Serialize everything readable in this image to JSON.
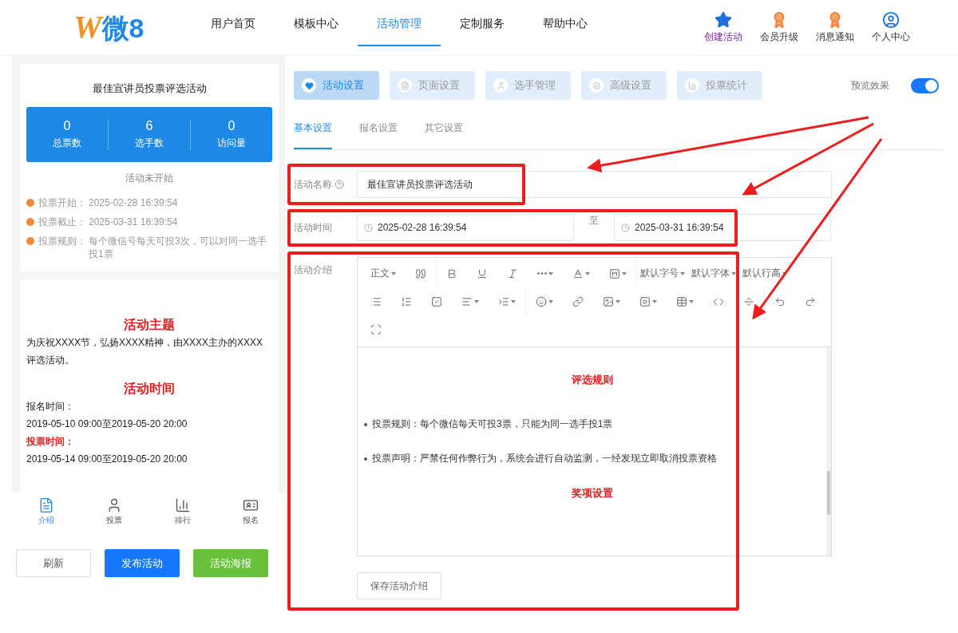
{
  "header": {
    "logo_mark": "W",
    "logo_text": "微8",
    "nav": [
      {
        "label": "用户首页",
        "selected": false
      },
      {
        "label": "模板中心",
        "selected": false
      },
      {
        "label": "活动管理",
        "selected": true
      },
      {
        "label": "定制服务",
        "selected": false
      },
      {
        "label": "帮助中心",
        "selected": false
      }
    ],
    "actions": [
      {
        "label": "创建活动",
        "kind": "stars"
      },
      {
        "label": "会员升级",
        "kind": "badge"
      },
      {
        "label": "消息通知",
        "kind": "badge"
      },
      {
        "label": "个人中心",
        "kind": "user"
      }
    ]
  },
  "preview": {
    "title": "最佳宣讲员投票评选活动",
    "stats": [
      {
        "value": "0",
        "label": "总票数"
      },
      {
        "value": "6",
        "label": "选手数"
      },
      {
        "value": "0",
        "label": "访问量"
      }
    ],
    "status": "活动未开始",
    "info": [
      {
        "label": "投票开始：",
        "value": "2025-02-28 16:39:54"
      },
      {
        "label": "投票截止：",
        "value": "2025-03-31 16:39:54"
      },
      {
        "label": "投票规则：",
        "value": "每个微信号每天可投3次，可以对同一选手投1票"
      }
    ],
    "content": [
      {
        "kind": "heading",
        "text": "活动主题"
      },
      {
        "kind": "text",
        "text": "为庆祝XXXX节，弘扬XXXX精神，由XXXX主办的XXXX评选活动。"
      },
      {
        "kind": "heading",
        "text": "活动时间"
      },
      {
        "kind": "text",
        "text": "报名时间："
      },
      {
        "kind": "text",
        "text": "2019-05-10 09:00至2019-05-20 20:00"
      },
      {
        "kind": "label",
        "text": "投票时间："
      },
      {
        "kind": "text",
        "text": "2019-05-14 09:00至2019-05-20 20:00"
      }
    ],
    "tabbar": [
      {
        "label": "介绍",
        "kind": "doc",
        "selected": true
      },
      {
        "label": "投票",
        "kind": "user",
        "selected": false
      },
      {
        "label": "排行",
        "kind": "chart",
        "selected": false
      },
      {
        "label": "报名",
        "kind": "card",
        "selected": false
      }
    ],
    "buttons": [
      {
        "label": "刷新",
        "kind": "plain"
      },
      {
        "label": "发布活动",
        "kind": "primary"
      },
      {
        "label": "活动海报",
        "kind": "success"
      }
    ]
  },
  "main_tabs": [
    {
      "label": "活动设置",
      "kind": "heart",
      "selected": true
    },
    {
      "label": "页面设置",
      "kind": "page",
      "selected": false
    },
    {
      "label": "选手管理",
      "kind": "user",
      "selected": false
    },
    {
      "label": "高级设置",
      "kind": "gear",
      "selected": false
    },
    {
      "label": "投票统计",
      "kind": "chart",
      "selected": false
    }
  ],
  "preview_toggle": {
    "label": "预览效果",
    "on": true
  },
  "sub_tabs": [
    {
      "label": "基本设置",
      "selected": true
    },
    {
      "label": "报名设置",
      "selected": false
    },
    {
      "label": "其它设置",
      "selected": false
    }
  ],
  "form": {
    "name": {
      "label": "活动名称",
      "value": "最佳宣讲员投票评选活动"
    },
    "time": {
      "label": "活动时间",
      "start": "2025-02-28 16:39:54",
      "separator": "至",
      "end": "2025-03-31 16:39:54"
    },
    "intro": {
      "label": "活动介绍",
      "toolbar": [
        [
          [
            {
              "kind": "text",
              "label": "正文",
              "dropdown": true
            },
            {
              "kind": "quote",
              "dropdown": false
            }
          ],
          [
            {
              "kind": "bold",
              "dropdown": false
            },
            {
              "kind": "underline",
              "dropdown": false
            },
            {
              "kind": "italic",
              "dropdown": false
            },
            {
              "kind": "more",
              "dropdown": true
            },
            {
              "kind": "font-color",
              "dropdown": true
            },
            {
              "kind": "bg-color",
              "dropdown": true
            }
          ],
          [
            {
              "kind": "text",
              "label": "默认字号",
              "dropdown": true
            },
            {
              "kind": "text",
              "label": "默认字体",
              "dropdown": true
            },
            {
              "kind": "text",
              "label": "默认行高",
              "dropdown": true
            }
          ]
        ],
        [
          [
            {
              "kind": "bullets",
              "dropdown": false
            },
            {
              "kind": "numbers",
              "dropdown": false
            },
            {
              "kind": "todo",
              "dropdown": false
            },
            {
              "kind": "align",
              "dropdown": true
            },
            {
              "kind": "indent",
              "dropdown": true
            }
          ],
          [
            {
              "kind": "emoji",
              "dropdown": true
            },
            {
              "kind": "link",
              "dropdown": false
            },
            {
              "kind": "image",
              "dropdown": true
            },
            {
              "kind": "video",
              "dropdown": true
            },
            {
              "kind": "table",
              "dropdown": true
            },
            {
              "kind": "code",
              "dropdown": false
            },
            {
              "kind": "divider",
              "dropdown": false
            }
          ],
          [
            {
              "kind": "undo",
              "dropdown": false
            },
            {
              "kind": "redo",
              "dropdown": false
            }
          ]
        ],
        [
          [
            {
              "kind": "fullscreen",
              "dropdown": false
            }
          ]
        ]
      ],
      "body": [
        {
          "kind": "heading",
          "text": "评选规则"
        },
        {
          "kind": "bullet",
          "text": "投票规则：每个微信每天可投3票，只能为同一选手投1票"
        },
        {
          "kind": "bullet",
          "text": "投票声明：严禁任何作弊行为，系统会进行自动监测，一经发现立即取消投票资格"
        },
        {
          "kind": "heading",
          "text": "奖项设置"
        }
      ],
      "save_button": "保存活动介绍"
    }
  }
}
